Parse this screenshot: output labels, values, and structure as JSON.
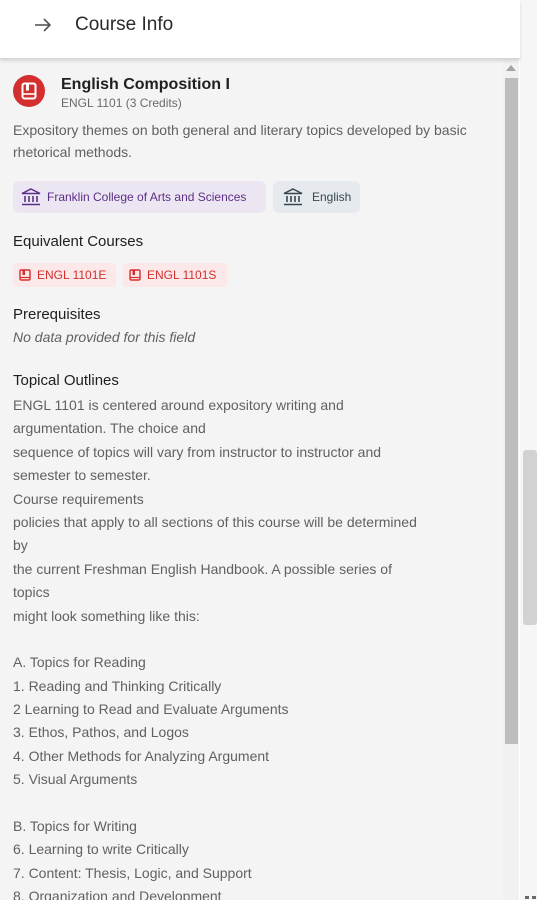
{
  "header": {
    "back_icon": "arrow-right-icon",
    "title": "Course Info"
  },
  "course": {
    "icon": "book-icon",
    "title": "English Composition I",
    "code": "ENGL 1101 (3 Credits)",
    "description": "Expository themes on both general and literary topics developed by basic rhetorical methods.",
    "college": "Franklin College of Arts and Sciences",
    "department": "English",
    "institution_icon": "institution-icon"
  },
  "equivalent": {
    "heading": "Equivalent Courses",
    "items": [
      "ENGL 1101E",
      "ENGL 1101S"
    ]
  },
  "prerequisites": {
    "heading": "Prerequisites",
    "value": "No data provided for this field"
  },
  "outlines": {
    "heading": "Topical Outlines",
    "lines": [
      "ENGL 1101 is centered around expository writing and",
      "argumentation. The choice and",
      "sequence of topics will vary from instructor to instructor and",
      "semester to semester.",
      "Course requirements",
      "policies that apply to all sections of this course will be determined",
      "by",
      "the current Freshman English Handbook. A possible series of",
      "topics",
      "might look something like this:",
      "",
      "A. Topics for Reading",
      "1. Reading and Thinking Critically",
      "2  Learning to Read and Evaluate Arguments",
      "3. Ethos, Pathos, and Logos",
      "4. Other Methods for Analyzing Argument",
      "5. Visual Arguments",
      "",
      "B. Topics for Writing",
      "6. Learning to write Critically",
      "7. Content: Thesis, Logic, and Support",
      "8. Organization and Development"
    ]
  },
  "colors": {
    "accent_red": "#d32f2f",
    "college_chip_bg": "#ece6f2",
    "college_chip_text": "#5b2f87",
    "dept_chip_bg": "#e6eaee",
    "equiv_chip_bg": "#fce8e8"
  }
}
